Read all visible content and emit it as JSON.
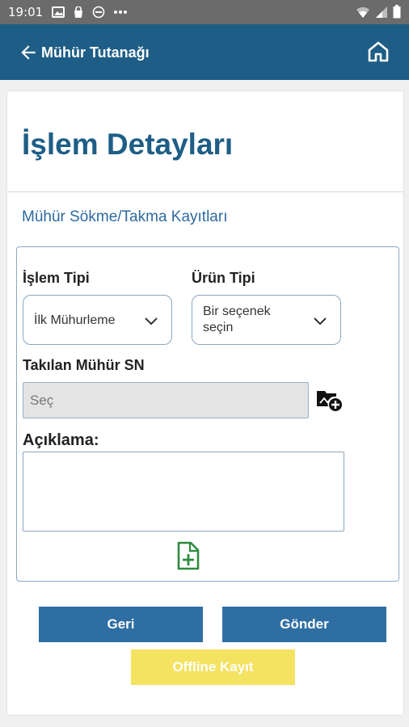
{
  "status_bar": {
    "time": "19:01",
    "icons": [
      "image-icon",
      "bag-icon",
      "dnd-icon",
      "more-icon",
      "wifi-icon",
      "signal-icon",
      "battery-icon"
    ]
  },
  "app_bar": {
    "title": "Mühür Tutanağı",
    "color": "#1e5e86"
  },
  "page": {
    "heading": "İşlem Detayları",
    "section_title": "Mühür Sökme/Takma Kayıtları"
  },
  "form": {
    "islem_tipi": {
      "label": "İşlem Tipi",
      "value": "İlk Mühurleme"
    },
    "urun_tipi": {
      "label": "Ürün Tipi",
      "value": "Bir seçenek seçin"
    },
    "takilan_muhur": {
      "label": "Takılan Mühür SN",
      "placeholder": "Seç"
    },
    "aciklama": {
      "label": "Açıklama:"
    }
  },
  "buttons": {
    "back": "Geri",
    "send": "Gönder",
    "offline": "Offline Kayıt"
  },
  "colors": {
    "primary": "#2f6ea3",
    "accent_yellow": "#f4e261",
    "icon_green": "#2e8b3e"
  }
}
